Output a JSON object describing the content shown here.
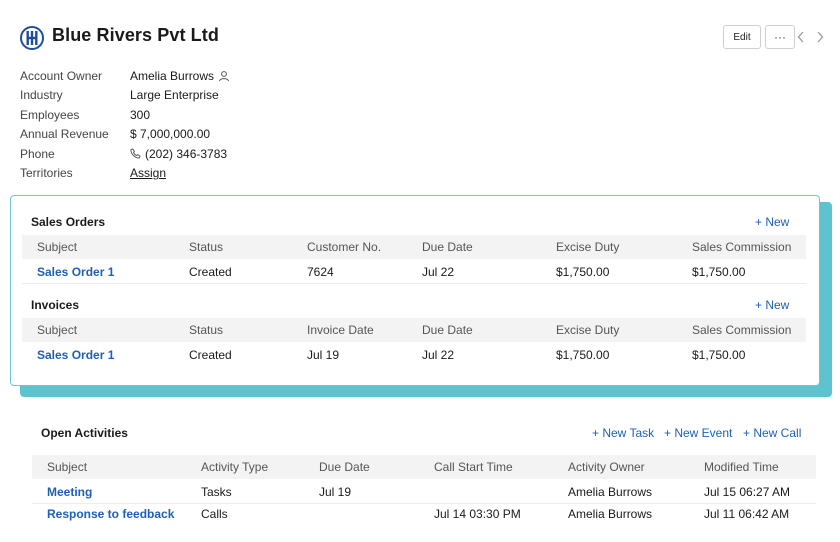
{
  "header": {
    "company_name": "Blue Rivers Pvt Ltd",
    "edit_label": "Edit",
    "more_label": "···"
  },
  "details": [
    {
      "label": "Account Owner",
      "value": "Amelia Burrows"
    },
    {
      "label": "Industry",
      "value": "Large Enterprise"
    },
    {
      "label": "Employees",
      "value": "300"
    },
    {
      "label": "Annual Revenue",
      "value": "$ 7,000,000.00"
    },
    {
      "label": "Phone",
      "value": "(202) 346-3783"
    },
    {
      "label": "Territories",
      "value": "Assign"
    }
  ],
  "sales_orders": {
    "title": "Sales Orders",
    "new_label": "+ New",
    "columns": [
      "Subject",
      "Status",
      "Customer No.",
      "Due Date",
      "Excise Duty",
      "Sales Commission"
    ],
    "rows": [
      [
        "Sales Order 1",
        "Created",
        "7624",
        "Jul 22",
        "$1,750.00",
        "$1,750.00"
      ]
    ]
  },
  "invoices": {
    "title": "Invoices",
    "new_label": "+ New",
    "columns": [
      "Subject",
      "Status",
      "Invoice Date",
      "Due Date",
      "Excise Duty",
      "Sales Commission"
    ],
    "rows": [
      [
        "Sales Order 1",
        "Created",
        "Jul 19",
        "Jul 22",
        "$1,750.00",
        "$1,750.00"
      ]
    ]
  },
  "open_activities": {
    "title": "Open Activities",
    "new_task_label": "+ New Task",
    "new_event_label": "+ New Event",
    "new_call_label": "+ New Call",
    "columns": [
      "Subject",
      "Activity Type",
      "Due Date",
      "Call Start Time",
      "Activity Owner",
      "Modified Time"
    ],
    "rows": [
      [
        "Meeting",
        "Tasks",
        "Jul 19",
        "",
        "Amelia Burrows",
        "Jul 15 06:27 AM"
      ],
      [
        "Response to feedback",
        "Calls",
        "",
        "Jul 14 03:30 PM",
        "Amelia Burrows",
        "Jul 11 06:42 AM"
      ]
    ]
  },
  "colors": {
    "accent": "#1f5fb5",
    "card_highlight": "#5fc3cf"
  },
  "icons": {
    "logo": "company-logo-icon",
    "owner": "user-icon",
    "phone": "phone-icon",
    "prev": "chevron-left-icon",
    "next": "chevron-right-icon"
  }
}
